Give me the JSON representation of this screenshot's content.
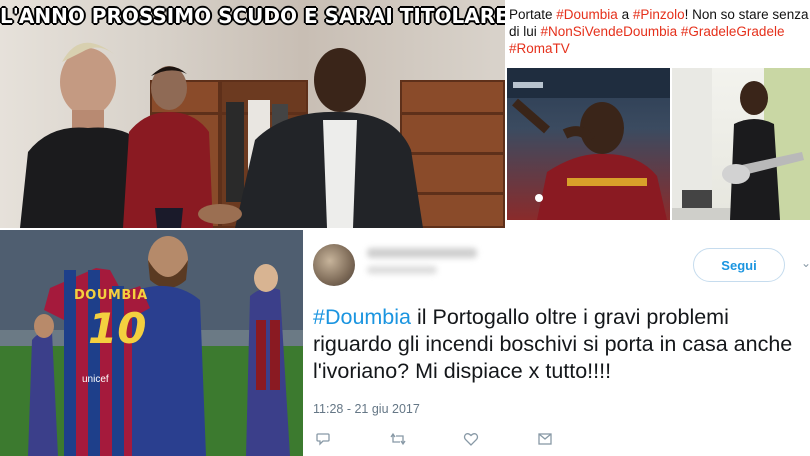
{
  "meme": {
    "caption": "L'ANNO PROSSIMO SCUDO E SARAI TITOLARE"
  },
  "instagram_post": {
    "text_parts": [
      {
        "t": "Portate ",
        "tag": false
      },
      {
        "t": "#Doumbia",
        "tag": true
      },
      {
        "t": " a ",
        "tag": false
      },
      {
        "t": "#Pinzolo",
        "tag": true
      },
      {
        "t": "! Non so stare senza di lui ",
        "tag": false
      },
      {
        "t": "#NonSiVendeDoumbia",
        "tag": true
      },
      {
        "t": " ",
        "tag": false
      },
      {
        "t": "#GradeleGradele",
        "tag": true
      },
      {
        "t": " ",
        "tag": false
      },
      {
        "t": "#RomaTV",
        "tag": true
      }
    ],
    "hashtag_color": "#e5301b"
  },
  "jersey": {
    "name": "DOUMBIA",
    "number": "10",
    "sponsor": "unicef"
  },
  "tweet": {
    "follow_label": "Segui",
    "hashtag": "#Doumbia",
    "body": " il Portogallo oltre i gravi problemi riguardo gli incendi boschivi si porta in casa anche l'ivoriano? Mi dispiace x tutto!!!!",
    "timestamp": "11:28 - 21 giu 2017",
    "accent_color": "#1b95e0",
    "icons": [
      "reply-icon",
      "retweet-icon",
      "like-icon",
      "message-icon"
    ]
  }
}
